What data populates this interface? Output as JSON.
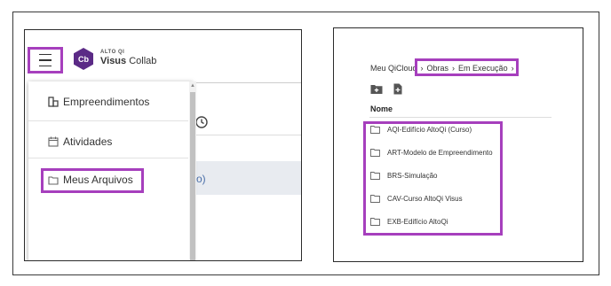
{
  "left": {
    "brand": {
      "small": "ALTO QI",
      "strong": "Visus",
      "light": "Collab",
      "logo_text": "Cb",
      "logo_color": "#5b2a86"
    },
    "background_fragment": "so)",
    "menu": [
      {
        "label": "Empreendimentos",
        "icon": "building-icon"
      },
      {
        "label": "Atividades",
        "icon": "calendar-icon"
      },
      {
        "label": "Meus Arquivos",
        "icon": "folder-icon"
      }
    ]
  },
  "right": {
    "breadcrumb": [
      "Meu QiCloud",
      "Obras",
      "Em Execução"
    ],
    "column_header": "Nome",
    "toolbar": [
      "new-folder-icon",
      "new-file-icon"
    ],
    "files": [
      "AQI-Edifício AltoQi (Curso)",
      "ART-Modelo de Empreendimento",
      "BRS-Simulação",
      "CAV-Curso AltoQi Visus",
      "EXB-Edifício AltoQi"
    ]
  },
  "colors": {
    "highlight": "#a63fbd",
    "link": "#4a6fa8"
  }
}
